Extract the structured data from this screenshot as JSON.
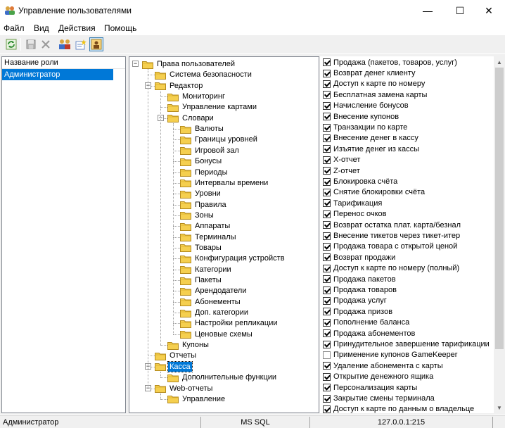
{
  "window": {
    "title": "Управление пользователями",
    "minimize": "—",
    "maximize": "☐",
    "close": "✕"
  },
  "menu": [
    "Файл",
    "Вид",
    "Действия",
    "Помощь"
  ],
  "toolbar": {
    "icons": [
      "refresh-icon",
      "save-icon",
      "delete-icon",
      "users-icon",
      "new-role-icon",
      "user-properties-icon"
    ]
  },
  "roles": {
    "header": "Название роли",
    "items": [
      "Администратор"
    ]
  },
  "tree": {
    "items": [
      {
        "label": "Права пользователей"
      },
      {
        "label": "Система безопасности"
      },
      {
        "label": "Редактор"
      },
      {
        "label": "Мониторинг"
      },
      {
        "label": "Управление картами"
      },
      {
        "label": "Словари"
      },
      {
        "label": "Валюты"
      },
      {
        "label": "Границы уровней"
      },
      {
        "label": "Игровой зал"
      },
      {
        "label": "Бонусы"
      },
      {
        "label": "Периоды"
      },
      {
        "label": "Интервалы времени"
      },
      {
        "label": "Уровни"
      },
      {
        "label": "Правила"
      },
      {
        "label": "Зоны"
      },
      {
        "label": "Аппараты"
      },
      {
        "label": "Терминалы"
      },
      {
        "label": "Товары"
      },
      {
        "label": "Конфигурация устройств"
      },
      {
        "label": "Категории"
      },
      {
        "label": "Пакеты"
      },
      {
        "label": "Арендодатели"
      },
      {
        "label": "Абонементы"
      },
      {
        "label": "Доп. категории"
      },
      {
        "label": "Настройки репликации"
      },
      {
        "label": "Ценовые схемы"
      },
      {
        "label": "Купоны"
      },
      {
        "label": "Отчеты"
      },
      {
        "label": "Касса"
      },
      {
        "label": "Дополнительные функции"
      },
      {
        "label": "Web-отчеты"
      },
      {
        "label": "Управление"
      }
    ]
  },
  "permissions": [
    {
      "label": "Продажа (пакетов, товаров, услуг)",
      "checked": true
    },
    {
      "label": "Возврат денег клиенту",
      "checked": true
    },
    {
      "label": "Доступ к карте по номеру",
      "checked": true
    },
    {
      "label": "Бесплатная замена карты",
      "checked": true
    },
    {
      "label": "Начисление бонусов",
      "checked": true
    },
    {
      "label": "Внесение купонов",
      "checked": true
    },
    {
      "label": "Транзакции по карте",
      "checked": true
    },
    {
      "label": "Внесение денег в кассу",
      "checked": true
    },
    {
      "label": "Изъятие денег из кассы",
      "checked": true
    },
    {
      "label": "X-отчет",
      "checked": true
    },
    {
      "label": "Z-отчет",
      "checked": true
    },
    {
      "label": "Блокировка счёта",
      "checked": true
    },
    {
      "label": "Снятие блокировки счёта",
      "checked": true
    },
    {
      "label": "Тарификация",
      "checked": true
    },
    {
      "label": "Перенос очков",
      "checked": true
    },
    {
      "label": "Возврат остатка плат. карта/безнал",
      "checked": true
    },
    {
      "label": "Внесение тикетов через тикет-итер",
      "checked": true
    },
    {
      "label": "Продажа товара с открытой ценой",
      "checked": true
    },
    {
      "label": "Возврат продажи",
      "checked": true
    },
    {
      "label": "Доступ к карте по номеру (полный)",
      "checked": true
    },
    {
      "label": "Продажа пакетов",
      "checked": true
    },
    {
      "label": "Продажа товаров",
      "checked": true
    },
    {
      "label": "Продажа услуг",
      "checked": true
    },
    {
      "label": "Продажа призов",
      "checked": true
    },
    {
      "label": "Пополнение баланса",
      "checked": true
    },
    {
      "label": "Продажа абонементов",
      "checked": true
    },
    {
      "label": "Принудительное завершение тарификации",
      "checked": true
    },
    {
      "label": "Применение купонов GameKeeper",
      "checked": false
    },
    {
      "label": "Удаление абонемента с карты",
      "checked": true
    },
    {
      "label": "Открытие денежного ящика",
      "checked": true
    },
    {
      "label": "Персонализация карты",
      "checked": true
    },
    {
      "label": "Закрытие смены терминала",
      "checked": true
    },
    {
      "label": "Доступ к карте по данным о владельце",
      "checked": true
    }
  ],
  "status": {
    "user": "Администратор",
    "db": "MS SQL",
    "server": "127.0.0.1:215"
  }
}
